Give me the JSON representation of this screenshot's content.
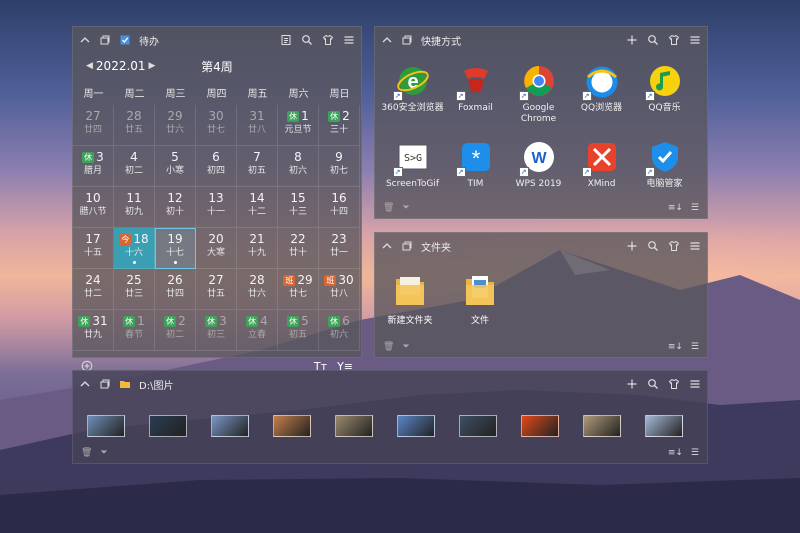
{
  "colors": {
    "today_bg": "#3b9fb4",
    "rest_badge": "#3ea35a",
    "work_badge": "#d9652f"
  },
  "calendar": {
    "title": "待办",
    "month": "2022.01",
    "week": "第4周",
    "weekdays": [
      "周一",
      "周二",
      "周三",
      "周四",
      "周五",
      "周六",
      "周日"
    ],
    "days": [
      {
        "num": "27",
        "lunar": "廿四",
        "dim": true
      },
      {
        "num": "28",
        "lunar": "廿五",
        "dim": true
      },
      {
        "num": "29",
        "lunar": "廿六",
        "dim": true
      },
      {
        "num": "30",
        "lunar": "廿七",
        "dim": true
      },
      {
        "num": "31",
        "lunar": "廿八",
        "dim": true
      },
      {
        "num": "1",
        "lunar": "元旦节",
        "badge": "休",
        "badge_type": "rest"
      },
      {
        "num": "2",
        "lunar": "三十",
        "badge": "休",
        "badge_type": "rest"
      },
      {
        "num": "3",
        "lunar": "腊月",
        "badge": "休",
        "badge_type": "rest"
      },
      {
        "num": "4",
        "lunar": "初二"
      },
      {
        "num": "5",
        "lunar": "小寒"
      },
      {
        "num": "6",
        "lunar": "初四"
      },
      {
        "num": "7",
        "lunar": "初五"
      },
      {
        "num": "8",
        "lunar": "初六"
      },
      {
        "num": "9",
        "lunar": "初七"
      },
      {
        "num": "10",
        "lunar": "腊八节"
      },
      {
        "num": "11",
        "lunar": "初九"
      },
      {
        "num": "12",
        "lunar": "初十"
      },
      {
        "num": "13",
        "lunar": "十一"
      },
      {
        "num": "14",
        "lunar": "十二"
      },
      {
        "num": "15",
        "lunar": "十三"
      },
      {
        "num": "16",
        "lunar": "十四"
      },
      {
        "num": "17",
        "lunar": "十五"
      },
      {
        "num": "18",
        "lunar": "十六",
        "badge": "今",
        "badge_type": "work",
        "state": "today",
        "dot": true
      },
      {
        "num": "19",
        "lunar": "十七",
        "state": "selected",
        "dot": true
      },
      {
        "num": "20",
        "lunar": "大寒"
      },
      {
        "num": "21",
        "lunar": "十九"
      },
      {
        "num": "22",
        "lunar": "廿十"
      },
      {
        "num": "23",
        "lunar": "廿一"
      },
      {
        "num": "24",
        "lunar": "廿二"
      },
      {
        "num": "25",
        "lunar": "廿三"
      },
      {
        "num": "26",
        "lunar": "廿四"
      },
      {
        "num": "27",
        "lunar": "廿五"
      },
      {
        "num": "28",
        "lunar": "廿六"
      },
      {
        "num": "29",
        "lunar": "廿七",
        "badge": "班",
        "badge_type": "work"
      },
      {
        "num": "30",
        "lunar": "廿八",
        "badge": "班",
        "badge_type": "work"
      },
      {
        "num": "31",
        "lunar": "廿九",
        "badge": "休",
        "badge_type": "rest"
      },
      {
        "num": "1",
        "lunar": "春节",
        "badge": "休",
        "badge_type": "rest",
        "dim": true
      },
      {
        "num": "2",
        "lunar": "初二",
        "badge": "休",
        "badge_type": "rest",
        "dim": true
      },
      {
        "num": "3",
        "lunar": "初三",
        "badge": "休",
        "badge_type": "rest",
        "dim": true
      },
      {
        "num": "4",
        "lunar": "立春",
        "badge": "休",
        "badge_type": "rest",
        "dim": true
      },
      {
        "num": "5",
        "lunar": "初五",
        "badge": "休",
        "badge_type": "rest",
        "dim": true
      },
      {
        "num": "6",
        "lunar": "初六",
        "badge": "休",
        "badge_type": "rest",
        "dim": true
      }
    ],
    "footer": {
      "text_size": "Tт",
      "filter": "Y≡"
    }
  },
  "shortcuts": {
    "title": "快捷方式",
    "items": [
      {
        "label": "360安全浏览器",
        "icon": "ie-icon"
      },
      {
        "label": "Foxmail",
        "icon": "foxmail-icon"
      },
      {
        "label": "Google Chrome",
        "icon": "chrome-icon"
      },
      {
        "label": "QQ浏览器",
        "icon": "qqbrowser-icon"
      },
      {
        "label": "QQ音乐",
        "icon": "qqmusic-icon"
      },
      {
        "label": "ScreenToGif",
        "icon": "screentogif-icon"
      },
      {
        "label": "TIM",
        "icon": "tim-icon"
      },
      {
        "label": "WPS 2019",
        "icon": "wps-icon"
      },
      {
        "label": "XMind",
        "icon": "xmind-icon"
      },
      {
        "label": "电脑管家",
        "icon": "pcmanager-icon"
      }
    ]
  },
  "folder": {
    "title": "文件夹",
    "items": [
      {
        "label": "新建文件夹",
        "icon": "folder-icon"
      },
      {
        "label": "文件",
        "icon": "folder-doc-icon"
      }
    ]
  },
  "images": {
    "title": "D:\\图片",
    "thumb_colors": [
      "#6f8fb7",
      "#2a3d52",
      "#7a96c4",
      "#c57f4a",
      "#9b8a6c",
      "#5b86c8",
      "#3e4f62",
      "#e04a1a",
      "#b09a7a",
      "#a5b8d6"
    ]
  }
}
